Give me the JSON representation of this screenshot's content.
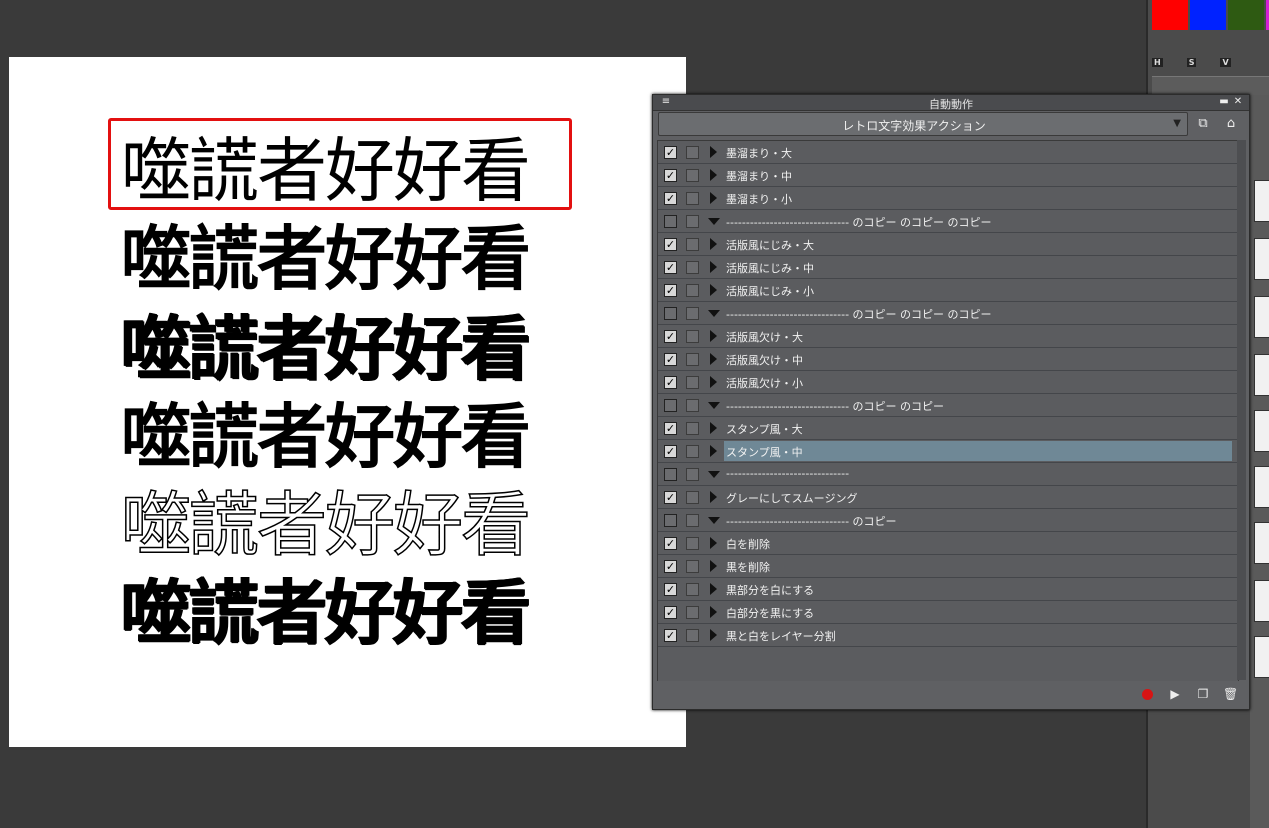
{
  "canvas": {
    "samples": [
      "噬謊者好好看",
      "噬謊者好好看",
      "噬謊者好好看",
      "噬謊者好好看",
      "噬謊者好好看",
      "噬謊者好好看"
    ]
  },
  "dock": {
    "swatches": [
      "#ff0000",
      "#0022ff",
      "#2e5a12",
      "#d51fd5"
    ],
    "hsv": [
      "H",
      "S",
      "V"
    ]
  },
  "panel": {
    "title": "自動動作",
    "set_name": "レトロ文字効果アクション",
    "rows": [
      {
        "checked": true,
        "expand": "right",
        "label": "墨溜まり・大"
      },
      {
        "checked": true,
        "expand": "right",
        "label": "墨溜まり・中"
      },
      {
        "checked": true,
        "expand": "right",
        "label": "墨溜まり・小"
      },
      {
        "checked": false,
        "expand": "down",
        "label": "------------------------------- のコピー のコピー のコピー"
      },
      {
        "checked": true,
        "expand": "right",
        "label": "活版風にじみ・大"
      },
      {
        "checked": true,
        "expand": "right",
        "label": "活版風にじみ・中"
      },
      {
        "checked": true,
        "expand": "right",
        "label": "活版風にじみ・小"
      },
      {
        "checked": false,
        "expand": "down",
        "label": "------------------------------- のコピー のコピー のコピー"
      },
      {
        "checked": true,
        "expand": "right",
        "label": "活版風欠け・大"
      },
      {
        "checked": true,
        "expand": "right",
        "label": "活版風欠け・中"
      },
      {
        "checked": true,
        "expand": "right",
        "label": "活版風欠け・小"
      },
      {
        "checked": false,
        "expand": "down",
        "label": "------------------------------- のコピー のコピー"
      },
      {
        "checked": true,
        "expand": "right",
        "label": "スタンプ風・大"
      },
      {
        "checked": true,
        "expand": "right",
        "label": "スタンプ風・中",
        "active": true
      },
      {
        "checked": false,
        "expand": "down",
        "label": "-------------------------------"
      },
      {
        "checked": true,
        "expand": "right",
        "label": "グレーにしてスムージング"
      },
      {
        "checked": false,
        "expand": "down",
        "label": "------------------------------- のコピー"
      },
      {
        "checked": true,
        "expand": "right",
        "label": "白を削除"
      },
      {
        "checked": true,
        "expand": "right",
        "label": "黒を削除"
      },
      {
        "checked": true,
        "expand": "right",
        "label": "黒部分を白にする"
      },
      {
        "checked": true,
        "expand": "right",
        "label": "白部分を黒にする"
      },
      {
        "checked": true,
        "expand": "right",
        "label": "黒と白をレイヤー分割"
      }
    ]
  }
}
